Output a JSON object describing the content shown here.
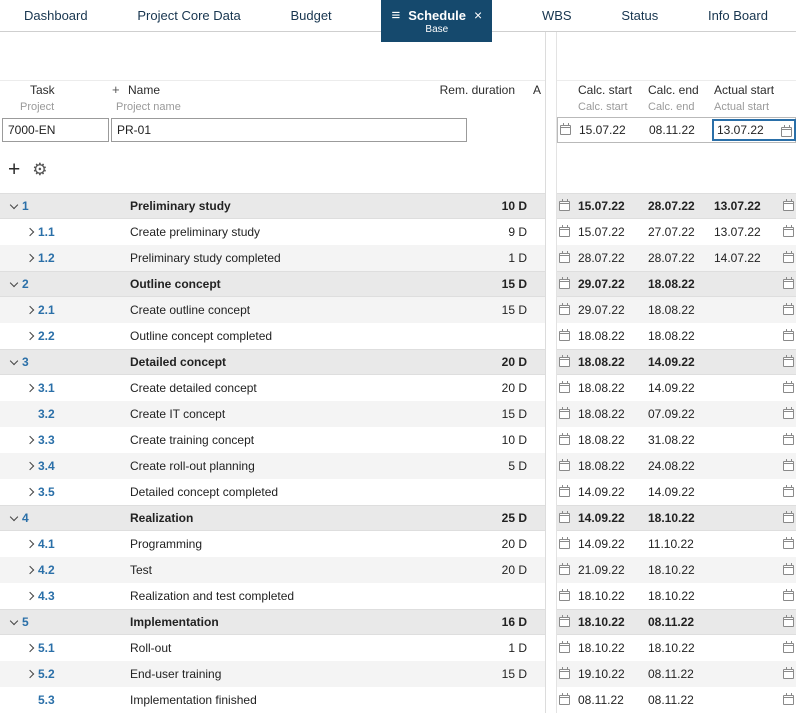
{
  "tabs": [
    {
      "label": "Dashboard"
    },
    {
      "label": "Project Core Data"
    },
    {
      "label": "Budget"
    },
    {
      "label": "Schedule",
      "sublabel": "Base",
      "active": true
    },
    {
      "label": "WBS"
    },
    {
      "label": "Status"
    },
    {
      "label": "Info Board"
    }
  ],
  "columns": {
    "task": "Task",
    "name": "Name",
    "rem_duration": "Rem. duration",
    "a": "A",
    "project": "Project",
    "project_name": "Project name",
    "calc_start": "Calc. start",
    "calc_end": "Calc. end",
    "actual_start": "Actual start"
  },
  "project": {
    "id": "7000-EN",
    "name": "PR-01",
    "calc_start": "15.07.22",
    "calc_end": "08.11.22",
    "actual_start": "13.07.22"
  },
  "icons": {
    "active_tab_menu": "menu-icon",
    "active_tab_close": "close-icon",
    "toolbar_add": "plus-icon",
    "toolbar_settings": "gear-icon",
    "date_fields": "calendar-icon",
    "expanded": "chevron-down-icon",
    "collapsed": "chevron-right-icon"
  },
  "colors": {
    "active_tab_bg": "#15496d",
    "task_number": "#2a6fa8",
    "group_row_bg": "#e9e9e9",
    "stripe_bg": "#f4f4f4",
    "highlight": "#2a6fa8"
  },
  "rows": [
    {
      "num": "1",
      "name": "Preliminary study",
      "dur": "10 D",
      "calc_start": "15.07.22",
      "calc_end": "28.07.22",
      "actual_start": "13.07.22",
      "group": true,
      "level": 1,
      "chevron": "down"
    },
    {
      "num": "1.1",
      "name": "Create preliminary study",
      "dur": "9 D",
      "calc_start": "15.07.22",
      "calc_end": "27.07.22",
      "actual_start": "13.07.22",
      "group": false,
      "level": 2,
      "chevron": "right"
    },
    {
      "num": "1.2",
      "name": "Preliminary study completed",
      "dur": "1 D",
      "calc_start": "28.07.22",
      "calc_end": "28.07.22",
      "actual_start": "14.07.22",
      "group": false,
      "level": 2,
      "chevron": "right"
    },
    {
      "num": "2",
      "name": "Outline concept",
      "dur": "15 D",
      "calc_start": "29.07.22",
      "calc_end": "18.08.22",
      "group": true,
      "level": 1,
      "chevron": "down"
    },
    {
      "num": "2.1",
      "name": "Create outline concept",
      "dur": "15 D",
      "calc_start": "29.07.22",
      "calc_end": "18.08.22",
      "group": false,
      "level": 2,
      "chevron": "right"
    },
    {
      "num": "2.2",
      "name": "Outline concept completed",
      "calc_start": "18.08.22",
      "calc_end": "18.08.22",
      "group": false,
      "level": 2,
      "chevron": "right"
    },
    {
      "num": "3",
      "name": "Detailed concept",
      "dur": "20 D",
      "calc_start": "18.08.22",
      "calc_end": "14.09.22",
      "group": true,
      "level": 1,
      "chevron": "down"
    },
    {
      "num": "3.1",
      "name": "Create detailed concept",
      "dur": "20 D",
      "calc_start": "18.08.22",
      "calc_end": "14.09.22",
      "group": false,
      "level": 2,
      "chevron": "right"
    },
    {
      "num": "3.2",
      "name": "Create IT concept",
      "dur": "15 D",
      "calc_start": "18.08.22",
      "calc_end": "07.09.22",
      "group": false,
      "level": 2,
      "chevron": "none"
    },
    {
      "num": "3.3",
      "name": "Create training concept",
      "dur": "10 D",
      "calc_start": "18.08.22",
      "calc_end": "31.08.22",
      "group": false,
      "level": 2,
      "chevron": "right"
    },
    {
      "num": "3.4",
      "name": "Create roll-out planning",
      "dur": "5 D",
      "calc_start": "18.08.22",
      "calc_end": "24.08.22",
      "group": false,
      "level": 2,
      "chevron": "right"
    },
    {
      "num": "3.5",
      "name": "Detailed concept completed",
      "calc_start": "14.09.22",
      "calc_end": "14.09.22",
      "group": false,
      "level": 2,
      "chevron": "right"
    },
    {
      "num": "4",
      "name": "Realization",
      "dur": "25 D",
      "calc_start": "14.09.22",
      "calc_end": "18.10.22",
      "group": true,
      "level": 1,
      "chevron": "down"
    },
    {
      "num": "4.1",
      "name": "Programming",
      "dur": "20 D",
      "calc_start": "14.09.22",
      "calc_end": "11.10.22",
      "group": false,
      "level": 2,
      "chevron": "right"
    },
    {
      "num": "4.2",
      "name": "Test",
      "dur": "20 D",
      "calc_start": "21.09.22",
      "calc_end": "18.10.22",
      "group": false,
      "level": 2,
      "chevron": "right"
    },
    {
      "num": "4.3",
      "name": "Realization and test completed",
      "calc_start": "18.10.22",
      "calc_end": "18.10.22",
      "group": false,
      "level": 2,
      "chevron": "right"
    },
    {
      "num": "5",
      "name": "Implementation",
      "dur": "16 D",
      "calc_start": "18.10.22",
      "calc_end": "08.11.22",
      "group": true,
      "level": 1,
      "chevron": "down"
    },
    {
      "num": "5.1",
      "name": "Roll-out",
      "dur": "1 D",
      "calc_start": "18.10.22",
      "calc_end": "18.10.22",
      "group": false,
      "level": 2,
      "chevron": "right"
    },
    {
      "num": "5.2",
      "name": "End-user training",
      "dur": "15 D",
      "calc_start": "19.10.22",
      "calc_end": "08.11.22",
      "group": false,
      "level": 2,
      "chevron": "right"
    },
    {
      "num": "5.3",
      "name": "Implementation finished",
      "calc_start": "08.11.22",
      "calc_end": "08.11.22",
      "group": false,
      "level": 2,
      "chevron": "none"
    }
  ]
}
